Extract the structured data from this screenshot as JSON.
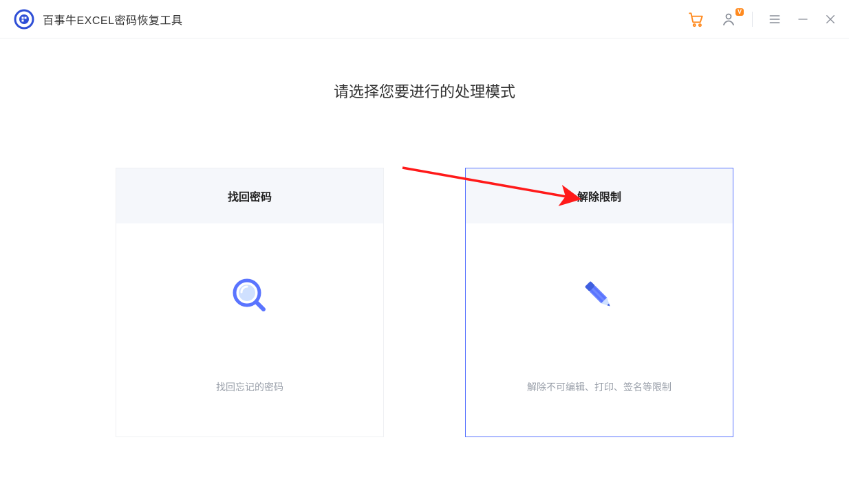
{
  "app": {
    "title": "百事牛EXCEL密码恢复工具"
  },
  "titlebar": {
    "account_badge": "V"
  },
  "main": {
    "title": "请选择您要进行的处理模式"
  },
  "cards": {
    "recover": {
      "title": "找回密码",
      "desc": "找回忘记的密码"
    },
    "unrestrict": {
      "title": "解除限制",
      "desc": "解除不可编辑、打印、签名等限制"
    }
  },
  "colors": {
    "accent": "#5a74ff",
    "cart": "#ff8a1f",
    "arrow": "#ff1a1a"
  }
}
